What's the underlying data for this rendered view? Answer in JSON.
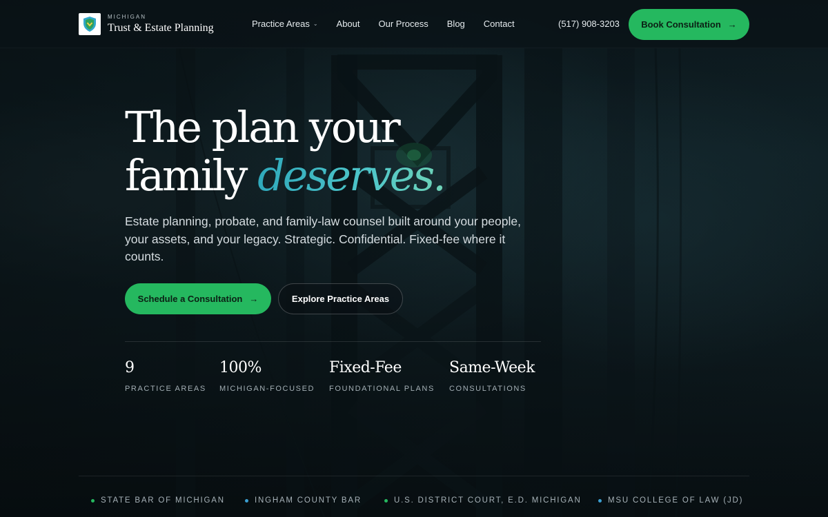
{
  "header": {
    "brand_eyebrow": "MICHIGAN",
    "brand_name": "Trust & Estate Planning",
    "logo_icon": "shield-icon",
    "nav": [
      {
        "label": "Practice Areas",
        "has_dropdown": true
      },
      {
        "label": "About"
      },
      {
        "label": "Our Process"
      },
      {
        "label": "Blog"
      },
      {
        "label": "Contact"
      }
    ],
    "phone": "(517) 908-3203",
    "cta_label": "Book Consultation",
    "cta_arrow": "→"
  },
  "hero": {
    "title_line1": "The plan your",
    "title_line2_plain": "family ",
    "title_line2_accent": "deserves.",
    "subtitle": "Estate planning, probate, and family-law counsel built around your people, your assets, and your legacy. Strategic. Confidential. Fixed-fee where it counts.",
    "primary_label": "Schedule a Consultation",
    "primary_arrow": "→",
    "secondary_label": "Explore Practice Areas"
  },
  "stats": [
    {
      "value": "9",
      "label": "PRACTICE AREAS"
    },
    {
      "value": "100%",
      "label": "MICHIGAN-FOCUSED"
    },
    {
      "value": "Fixed-Fee",
      "label": "FOUNDATIONAL PLANS"
    },
    {
      "value": "Same-Week",
      "label": "CONSULTATIONS"
    }
  ],
  "credentials": [
    {
      "label": "STATE BAR OF MICHIGAN",
      "dot_color": "#25b85f"
    },
    {
      "label": "INGHAM COUNTY BAR",
      "dot_color": "#3b9fd1"
    },
    {
      "label": "U.S. DISTRICT COURT, E.D. MICHIGAN",
      "dot_color": "#25b85f"
    },
    {
      "label": "MSU COLLEGE OF LAW (JD)",
      "dot_color": "#3b9fd1"
    }
  ],
  "colors": {
    "accent_green": "#25b85f",
    "accent_teal": "#43b5c4",
    "background": "#0b1418"
  }
}
